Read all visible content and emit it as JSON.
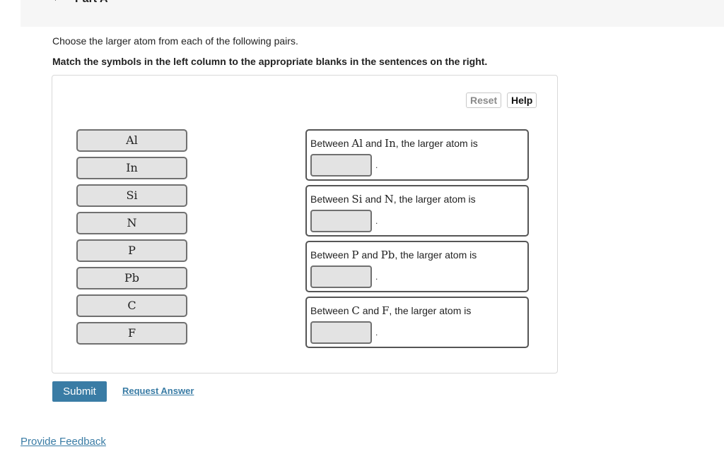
{
  "part": {
    "title": "Part A",
    "chevron_icon": "chevron-down-icon"
  },
  "instructions": {
    "prompt": "Choose the larger atom from each of the following pairs.",
    "directions": "Match the symbols in the left column to the appropriate blanks in the sentences on the right."
  },
  "toolbar": {
    "reset_label": "Reset",
    "help_label": "Help"
  },
  "symbols": [
    "Al",
    "In",
    "Si",
    "N",
    "P",
    "Pb",
    "C",
    "F"
  ],
  "sentences": [
    {
      "prefix": "Between ",
      "a": "Al",
      "mid": " and ",
      "b": "In",
      "suffix": ", the larger atom is",
      "blank_value": "",
      "end": "."
    },
    {
      "prefix": "Between ",
      "a": "Si",
      "mid": " and ",
      "b": "N",
      "suffix": ", the larger atom is",
      "blank_value": "",
      "end": "."
    },
    {
      "prefix": "Between ",
      "a": "P",
      "mid": " and ",
      "b": "Pb",
      "suffix": ", the larger atom is",
      "blank_value": "",
      "end": "."
    },
    {
      "prefix": "Between ",
      "a": "C",
      "mid": " and ",
      "b": "F",
      "suffix": ", the larger atom is",
      "blank_value": "",
      "end": "."
    }
  ],
  "actions": {
    "submit_label": "Submit",
    "request_answer_label": "Request Answer"
  },
  "footer": {
    "feedback_label": "Provide Feedback"
  },
  "colors": {
    "accent": "#3a7ca5",
    "chip_bg": "#e3e3e3",
    "header_bg": "#f6f6f6"
  }
}
